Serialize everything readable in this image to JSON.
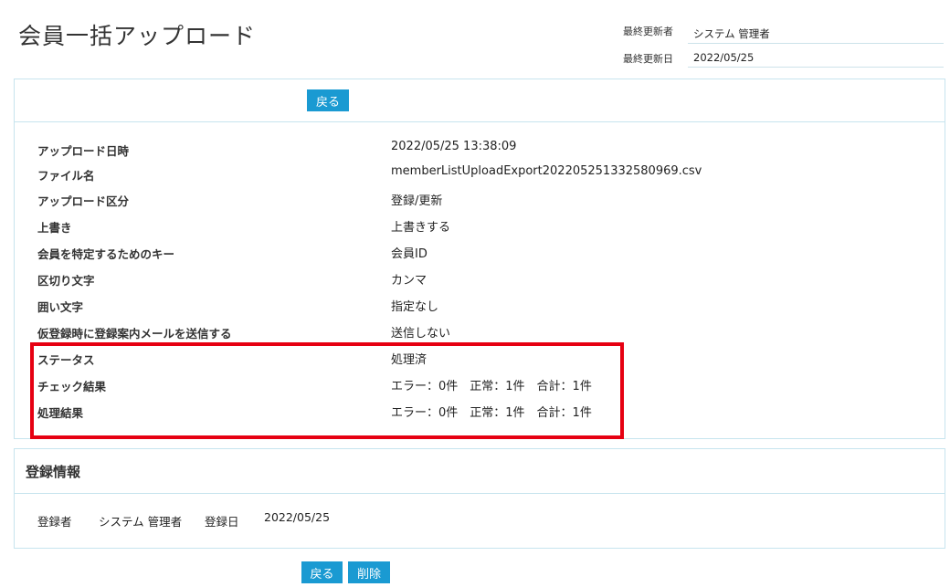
{
  "page": {
    "title": "会員一括アップロード"
  },
  "meta": {
    "updater_label": "最終更新者",
    "updater_value": "システム 管理者",
    "updated_label": "最終更新日",
    "updated_value": "2022/05/25"
  },
  "toolbar": {
    "back_label": "戻る"
  },
  "details": [
    {
      "label": "アップロード日時",
      "value": "2022/05/25 13:38:09"
    },
    {
      "label": "ファイル名",
      "value": "memberListUploadExport202205251332580969.csv"
    },
    {
      "label": "アップロード区分",
      "value": "登録/更新"
    },
    {
      "label": "上書き",
      "value": "上書きする"
    },
    {
      "label": "会員を特定するためのキー",
      "value": "会員ID"
    },
    {
      "label": "区切り文字",
      "value": "カンマ"
    },
    {
      "label": "囲い文字",
      "value": "指定なし"
    },
    {
      "label": "仮登録時に登録案内メールを送信する",
      "value": "送信しない"
    },
    {
      "label": "ステータス",
      "value": "処理済"
    },
    {
      "label": "チェック結果",
      "value": "エラー：0件　正常：1件　合計：1件"
    },
    {
      "label": "処理結果",
      "value": "エラー：0件　正常：1件　合計：1件"
    }
  ],
  "registration": {
    "section_title": "登録情報",
    "registrant_label": "登録者",
    "registrant_value": "システム 管理者",
    "date_label": "登録日",
    "date_value": "2022/05/25"
  },
  "footer": {
    "back_label": "戻る",
    "delete_label": "削除"
  },
  "colors": {
    "accent": "#1a9ad2",
    "highlight": "#e60012",
    "border": "#c7e4ee"
  }
}
